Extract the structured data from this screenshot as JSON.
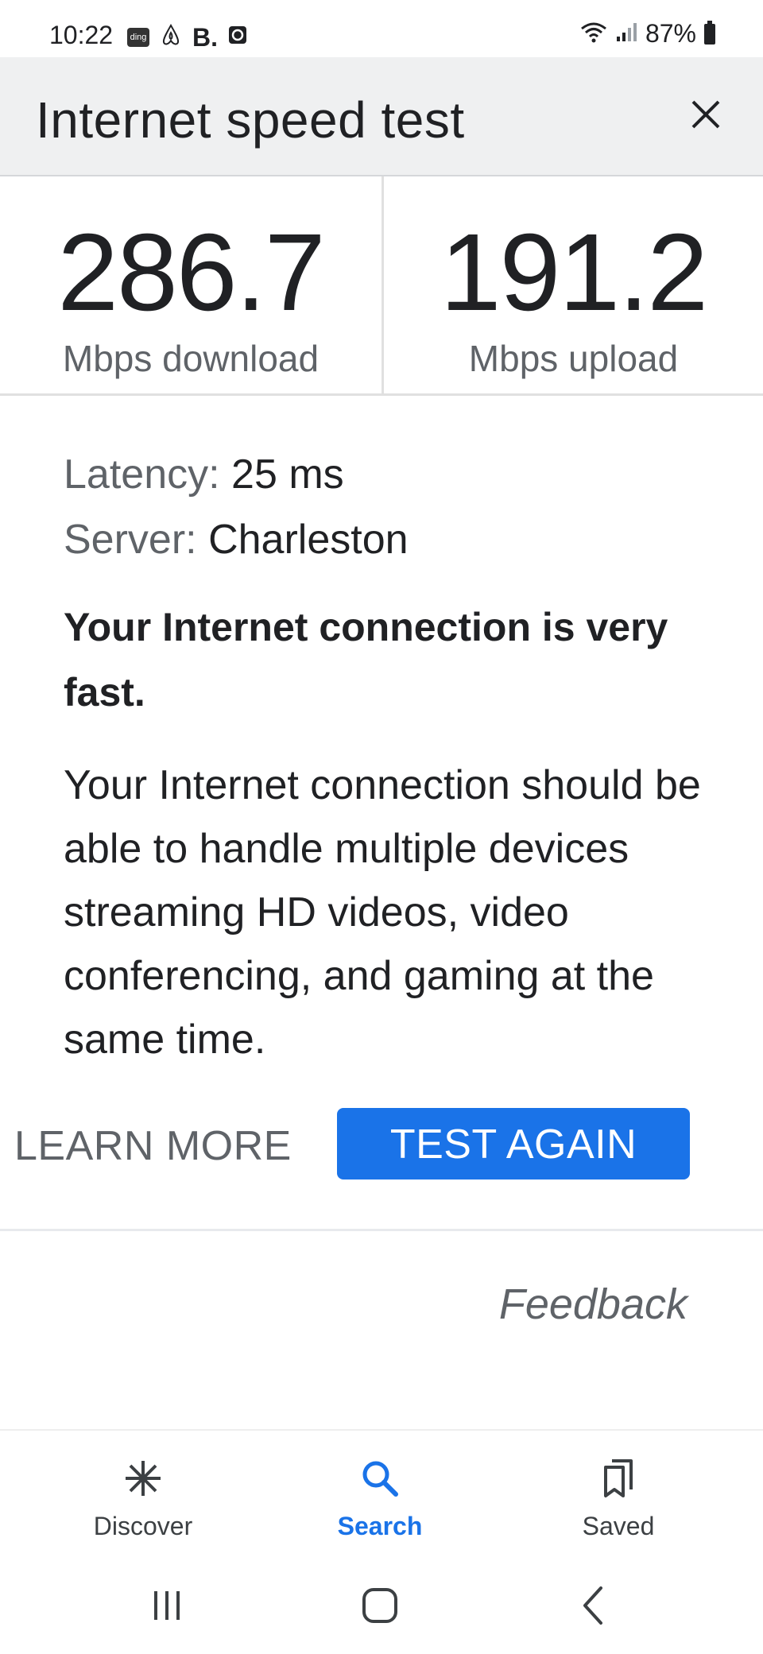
{
  "status_bar": {
    "time": "10:22",
    "notif_box_label": "ding",
    "notif_b": "B.",
    "battery": "87%"
  },
  "header": {
    "title": "Internet speed test"
  },
  "speed": {
    "download_value": "286.7",
    "download_label": "Mbps download",
    "upload_value": "191.2",
    "upload_label": "Mbps upload"
  },
  "details": {
    "latency_label": "Latency:",
    "latency_value": "25 ms",
    "server_label": "Server:",
    "server_value": "Charleston"
  },
  "summary": "Your Internet connection is very fast.",
  "description": "Your Internet connection should be able to handle multiple devices streaming HD videos, video conferencing, and gaming at the same time.",
  "actions": {
    "learn_more": "LEARN MORE",
    "test_again": "TEST AGAIN",
    "feedback": "Feedback"
  },
  "bottom_nav": {
    "items": [
      {
        "label": "Discover",
        "icon": "asterisk-icon"
      },
      {
        "label": "Search",
        "icon": "search-icon",
        "active": true
      },
      {
        "label": "Saved",
        "icon": "bookmarks-icon"
      }
    ]
  },
  "system_nav": [
    "recents",
    "home",
    "back"
  ],
  "colors": {
    "accent": "#1a73e8",
    "header_bg": "#eff0f1",
    "secondary_text": "#5f6368"
  }
}
